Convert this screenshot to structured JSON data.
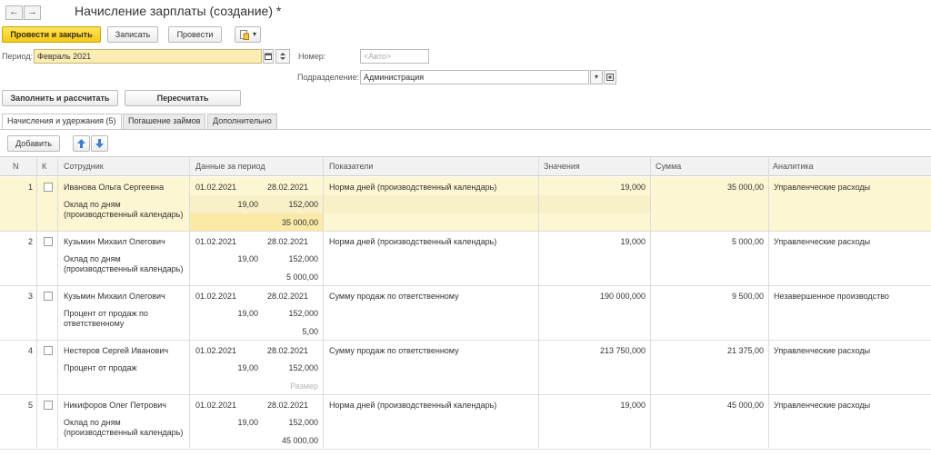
{
  "window": {
    "title": "Начисление зарплаты (создание) *",
    "back_glyph": "←",
    "forward_glyph": "→"
  },
  "toolbar": {
    "post_close_label": "Провести и закрыть",
    "save_label": "Записать",
    "post_label": "Провести",
    "more_glyph": "▾"
  },
  "form": {
    "period_label": "Период:",
    "period_value": "Февраль 2021",
    "number_label": "Номер:",
    "number_placeholder": "<Авто>",
    "department_label": "Подразделение:",
    "department_value": "Администрация"
  },
  "actions": {
    "fill_calc_label": "Заполнить и рассчитать",
    "recalc_label": "Пересчитать"
  },
  "tabs": [
    {
      "label": "Начисления и удержания (5)",
      "active": true
    },
    {
      "label": "Погашение займов",
      "active": false
    },
    {
      "label": "Дополнительно",
      "active": false
    }
  ],
  "table_toolbar": {
    "add_label": "Добавить",
    "up_glyph": "🡅",
    "down_glyph": "🡇"
  },
  "table": {
    "columns": {
      "n": "N",
      "k": "К",
      "employee": "Сотрудник",
      "period": "Данные за период",
      "indicators": "Показатели",
      "values": "Значения",
      "sum": "Сумма",
      "analytics": "Аналитика"
    },
    "rows": [
      {
        "n": "1",
        "employee": "Иванова Ольга Сергеевна",
        "accrual_line1": "Оклад по дням",
        "accrual_line2": "(производственный календарь)",
        "date_from": "01.02.2021",
        "date_to": "28.02.2021",
        "days": "19,00",
        "hours": "152,000",
        "result": "35 000,00",
        "indicator": "Норма дней (производственный календарь)",
        "value": "19,000",
        "sum": "35 000,00",
        "analytics": "Управленческие расходы",
        "result_muted": false
      },
      {
        "n": "2",
        "employee": "Кузьмин Михаил Олегович",
        "accrual_line1": "Оклад по дням",
        "accrual_line2": "(производственный календарь)",
        "date_from": "01.02.2021",
        "date_to": "28.02.2021",
        "days": "19,00",
        "hours": "152,000",
        "result": "5 000,00",
        "indicator": "Норма дней (производственный календарь)",
        "value": "19,000",
        "sum": "5 000,00",
        "analytics": "Управленческие расходы",
        "result_muted": false
      },
      {
        "n": "3",
        "employee": "Кузьмин Михаил Олегович",
        "accrual_line1": "Процент от продаж по",
        "accrual_line2": "ответственному",
        "date_from": "01.02.2021",
        "date_to": "28.02.2021",
        "days": "19,00",
        "hours": "152,000",
        "result": "5,00",
        "indicator": "Сумму продаж по ответственному",
        "value": "190 000,000",
        "sum": "9 500,00",
        "analytics": "Незавершенное производство",
        "result_muted": false
      },
      {
        "n": "4",
        "employee": "Нестеров Сергей Иванович",
        "accrual_line1": "Процент от продаж",
        "accrual_line2": "",
        "date_from": "01.02.2021",
        "date_to": "28.02.2021",
        "days": "19,00",
        "hours": "152,000",
        "result": "Размер",
        "indicator": "Сумму продаж по ответственному",
        "value": "213 750,000",
        "sum": "21 375,00",
        "analytics": "Управленческие расходы",
        "result_muted": true
      },
      {
        "n": "5",
        "employee": "Никифоров Олег Петрович",
        "accrual_line1": "Оклад по дням",
        "accrual_line2": "(производственный календарь)",
        "date_from": "01.02.2021",
        "date_to": "28.02.2021",
        "days": "19,00",
        "hours": "152,000",
        "result": "45 000,00",
        "indicator": "Норма дней (производственный календарь)",
        "value": "19,000",
        "sum": "45 000,00",
        "analytics": "Управленческие расходы",
        "result_muted": false
      }
    ]
  },
  "colors": {
    "primary_button": "#f5c91c",
    "selected_row": "#fdf6d2",
    "highlight_cell": "#fbe9a6",
    "period_field": "#fbedb4"
  }
}
